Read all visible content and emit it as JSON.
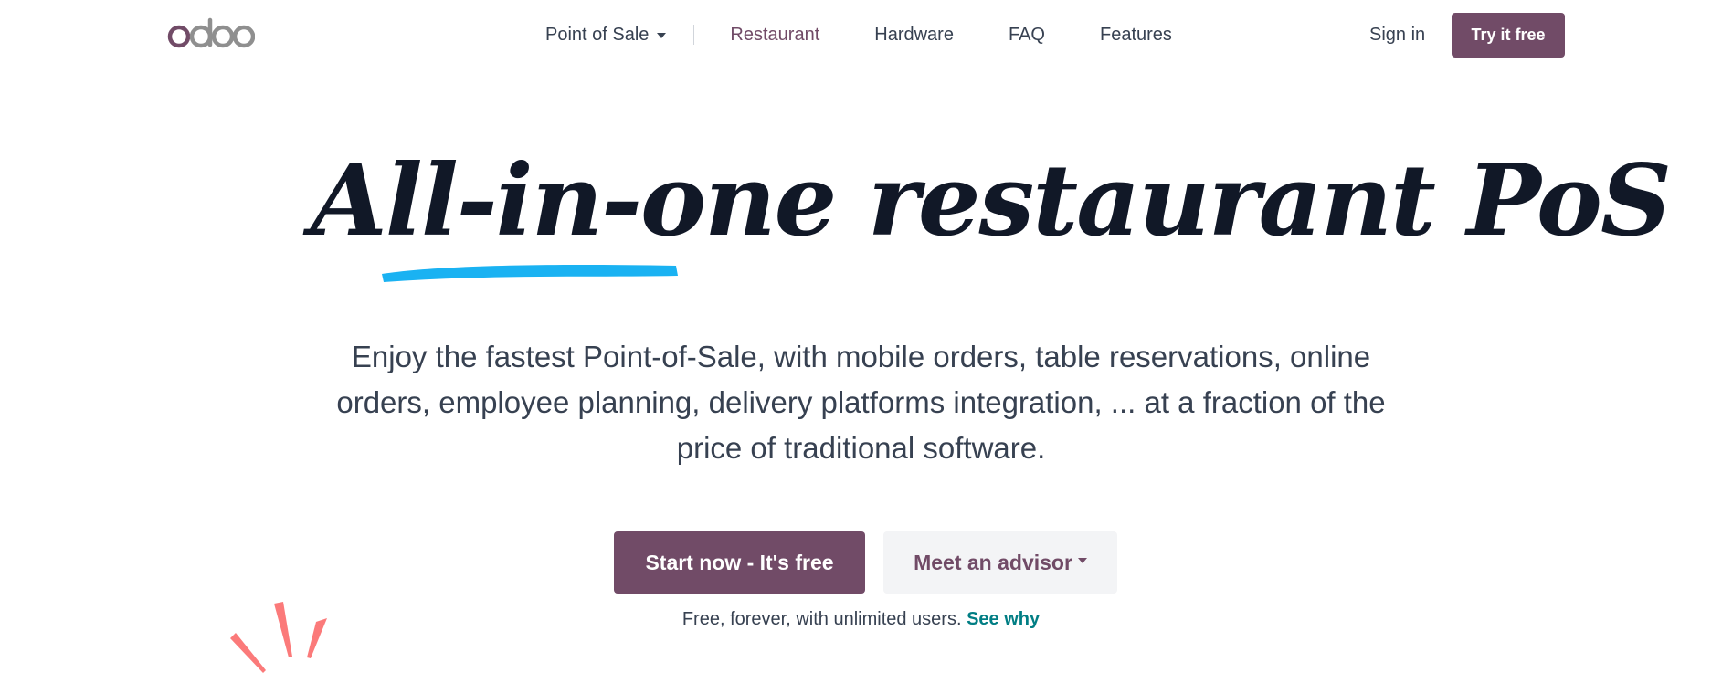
{
  "header": {
    "logo_text": "odoo",
    "nav": {
      "product_label": "Point of Sale",
      "items": [
        "Restaurant",
        "Hardware",
        "FAQ",
        "Features"
      ]
    },
    "signin_label": "Sign in",
    "try_label": "Try it free"
  },
  "hero": {
    "title": "All-in-one restaurant PoS",
    "subtitle": "Enjoy the fastest Point-of-Sale, with mobile orders, table reservations, online orders, employee planning, delivery platforms integration, ... at a fraction of the price of traditional software.",
    "cta_primary": "Start now - It's free",
    "cta_secondary": "Meet an advisor",
    "note": "Free, forever, with unlimited users.",
    "note_link": "See why"
  },
  "colors": {
    "brand": "#714b67",
    "underline": "#1ab2f2",
    "link": "#017e84",
    "sparkle": "#fb7a7a"
  },
  "icons": {
    "dropdown": "chevron-down-icon",
    "decoration": "sparkle-icon"
  }
}
